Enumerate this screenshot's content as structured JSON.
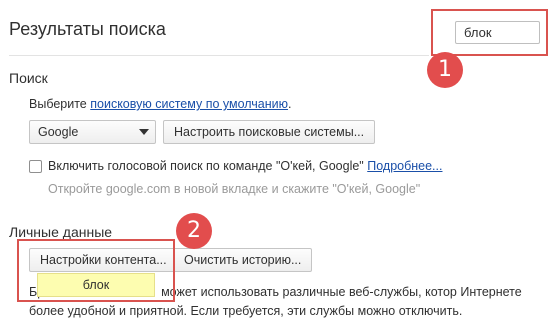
{
  "header": {
    "title": "Результаты поиска",
    "search_value": "блок"
  },
  "search_section": {
    "title": "Поиск",
    "select_prefix": "Выберите",
    "select_link": "поисковую систему по умолчанию",
    "select_suffix": ".",
    "engine_selected": "Google",
    "manage_button": "Настроить поисковые системы...",
    "voice_label": "Включить голосовой поиск по команде \"О'кей, Google\"",
    "voice_link": "Подробнее...",
    "voice_hint": "Откройте google.com в новой вкладке и скажите \"О'кей, Google\""
  },
  "privacy_section": {
    "title": "Личные данные",
    "content_settings_button": "Настройки контента...",
    "clear_history_button": "Очистить историю...",
    "desc_line1_start": "Бра",
    "desc_line1_end": "может использовать различные веб-службы, котор Интернете",
    "desc_line2": "более удобной и приятной. Если требуется, эти службы можно отключить.",
    "tooltip": "блок"
  },
  "annotations": {
    "badge1": "1",
    "badge2": "2",
    "color": "#e24d4d"
  }
}
